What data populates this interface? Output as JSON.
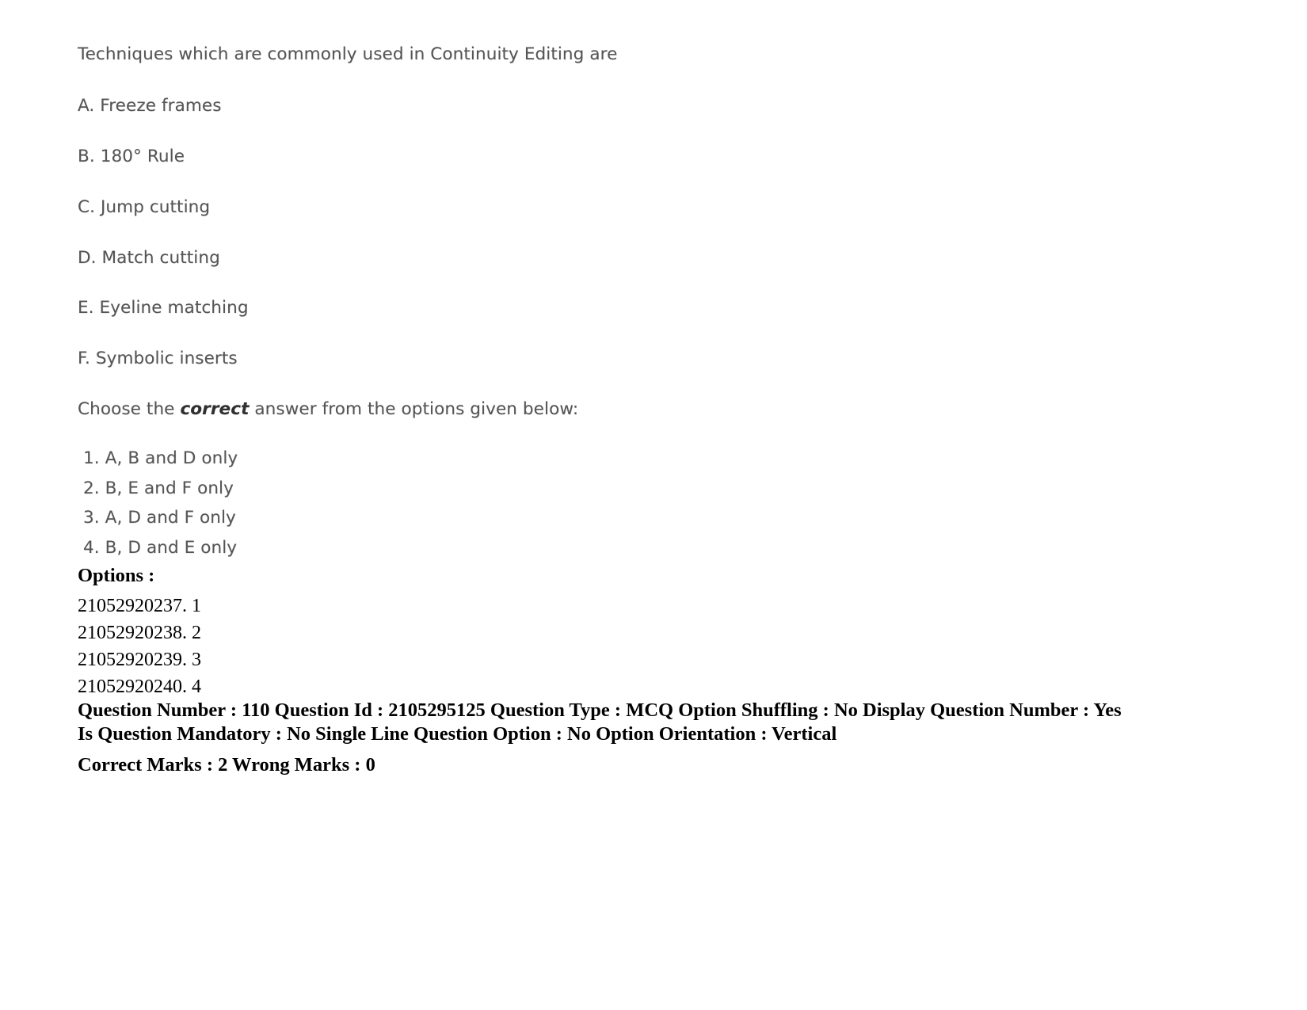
{
  "question": {
    "stem": "Techniques which are commonly used in Continuity Editing are",
    "statements": [
      "A. Freeze frames",
      "B. 180° Rule",
      "C. Jump cutting",
      "D. Match cutting",
      "E. Eyeline matching",
      "F. Symbolic inserts"
    ],
    "instruction_prefix": "Choose the ",
    "instruction_emphasis": "correct",
    "instruction_suffix": " answer from the options given below:",
    "choices": [
      "1. A, B and D only",
      "2. B, E and F only",
      "3. A, D and F only",
      "4. B, D and E only"
    ]
  },
  "options_section": {
    "heading": "Options :",
    "items": [
      "21052920237. 1",
      "21052920238. 2",
      "21052920239. 3",
      "21052920240. 4"
    ]
  },
  "metadata": {
    "line1": "Question Number : 110 Question Id : 2105295125 Question Type : MCQ Option Shuffling : No Display Question Number : Yes Is Question Mandatory : No Single Line Question Option : No Option Orientation : Vertical",
    "line2": "Correct Marks : 2 Wrong Marks : 0",
    "fields": {
      "question_number_label": "Question Number :",
      "question_number": "110",
      "question_id_label": "Question Id :",
      "question_id": "2105295125",
      "question_type_label": "Question Type :",
      "question_type": "MCQ",
      "option_shuffling_label": "Option Shuffling :",
      "option_shuffling": "No",
      "display_question_number_label": "Display Question Number :",
      "display_question_number": "Yes",
      "is_question_mandatory_label": "Is Question Mandatory :",
      "is_question_mandatory": "No",
      "single_line_question_option_label": "Single Line Question Option :",
      "single_line_question_option": "No",
      "option_orientation_label": "Option Orientation :",
      "option_orientation": "Vertical",
      "correct_marks_label": "Correct Marks :",
      "correct_marks": "2",
      "wrong_marks_label": "Wrong Marks :",
      "wrong_marks": "0"
    }
  },
  "colors": {
    "page_background": "#ffffff",
    "scanned_text": "#5a5a5a",
    "crisp_text": "#000000"
  }
}
